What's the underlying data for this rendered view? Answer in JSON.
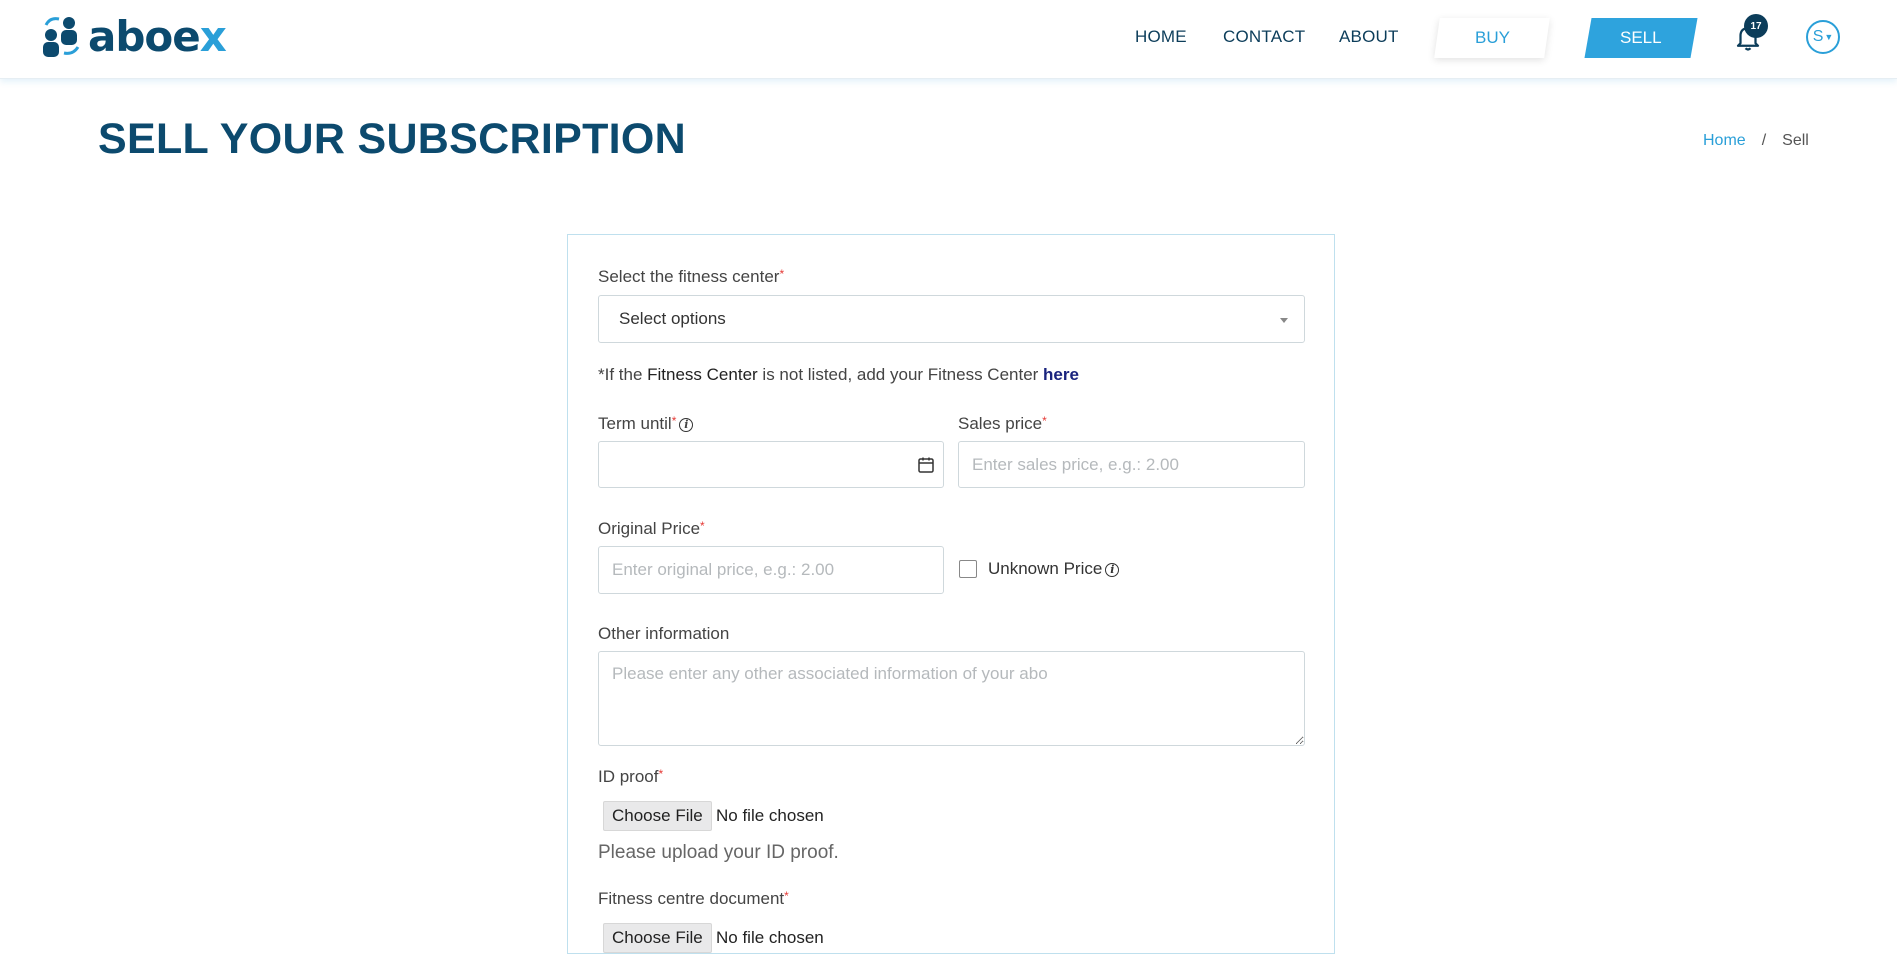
{
  "header": {
    "brand": {
      "name_main": "aboe",
      "name_accent": "x"
    },
    "nav": {
      "home": "HOME",
      "contact": "CONTACT",
      "about": "ABOUT",
      "buy": "BUY",
      "sell": "SELL"
    },
    "notifications_count": "17",
    "user_initial": "S",
    "icons": [
      "logo-people-icon",
      "bell-icon",
      "chevron-down-icon"
    ],
    "colors": {
      "primary": "#0c4a6e",
      "accent": "#2ea3dd",
      "required": "#e53935"
    }
  },
  "page": {
    "title": "SELL YOUR SUBSCRIPTION",
    "breadcrumb": {
      "home": "Home",
      "separator": "/",
      "current": "Sell"
    }
  },
  "form": {
    "fitness_center": {
      "label": "Select the fitness center",
      "required": "*",
      "value": "Select options"
    },
    "note": {
      "prefix": "*If the ",
      "bold": "Fitness Center",
      "middle": " is not listed, add your Fitness Center ",
      "link": "here"
    },
    "term_until": {
      "label": "Term until",
      "required": "*",
      "value": ""
    },
    "sales_price": {
      "label": "Sales price",
      "required": "*",
      "placeholder": "Enter sales price, e.g.: 2.00"
    },
    "original_price": {
      "label": "Original Price",
      "required": "*",
      "placeholder": "Enter original price, e.g.: 2.00"
    },
    "unknown_price": {
      "label": "Unknown Price",
      "checked": false
    },
    "other_info": {
      "label": "Other information",
      "placeholder": "Please enter any other associated information of your abo"
    },
    "id_proof": {
      "label": "ID proof",
      "required": "*",
      "button": "Choose File",
      "status": "No file chosen",
      "helper": "Please upload your ID proof."
    },
    "fitness_doc": {
      "label": "Fitness centre document",
      "required": "*",
      "button": "Choose File",
      "status": "No file chosen"
    }
  }
}
